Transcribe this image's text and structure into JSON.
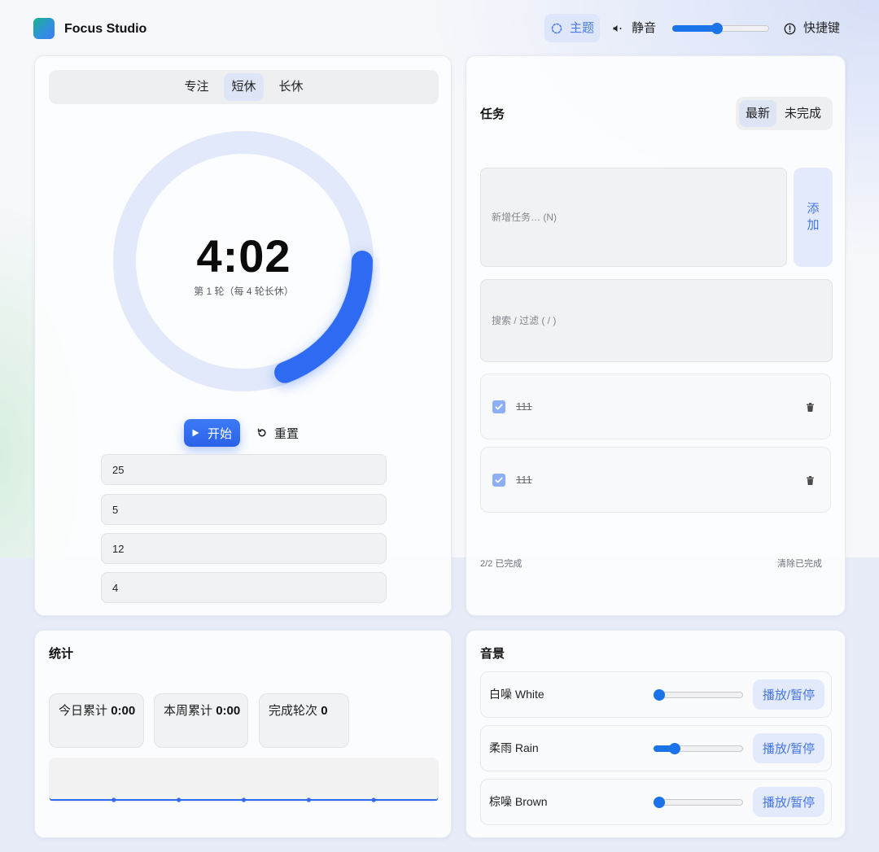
{
  "header": {
    "title": "Focus Studio",
    "theme_label": "主题",
    "theme_icon": "spinner-icon",
    "mute_label": "静音",
    "mute_icon": "speaker-icon",
    "volume": 0.46,
    "shortcuts_label": "快捷键",
    "shortcuts_icon": "info-icon"
  },
  "timer": {
    "modes": [
      {
        "label": "专注",
        "active": false
      },
      {
        "label": "短休",
        "active": true
      },
      {
        "label": "长休",
        "active": false
      }
    ],
    "time": "4:02",
    "round_info": "第 1 轮（每 4 轮长休）",
    "progress": 0.193,
    "start_label": "开始",
    "start_icon": "play-icon",
    "reset_label": "重置",
    "reset_icon": "reset-icon",
    "settings": [
      "25",
      "5",
      "12",
      "4"
    ]
  },
  "tasks": {
    "title": "任务",
    "filters": [
      {
        "label": "最新",
        "active": true
      },
      {
        "label": "未完成",
        "active": false
      }
    ],
    "new_placeholder": "新增任务… (N)",
    "add_label": "添加",
    "search_placeholder": "搜索 / 过滤 ( / )",
    "items": [
      {
        "text": "111",
        "done": true,
        "delete_icon": "trash-icon"
      },
      {
        "text": "111",
        "done": true,
        "delete_icon": "trash-icon"
      }
    ],
    "summary": "2/2 已完成",
    "clear_label": "清除已完成"
  },
  "stats": {
    "title": "统计",
    "cards": [
      {
        "label": "今日累计",
        "value": "0:00"
      },
      {
        "label": "本周累计",
        "value": "0:00"
      },
      {
        "label": "完成轮次",
        "value": "0"
      }
    ],
    "trend": {
      "type": "line",
      "values": [
        0,
        0,
        0,
        0,
        0,
        0,
        0
      ]
    }
  },
  "soundscape": {
    "title": "音景",
    "tracks": [
      {
        "label": "白噪 White",
        "volume": 0,
        "button_label": "播放/暂停"
      },
      {
        "label": "柔雨 Rain",
        "volume": 0.2,
        "button_label": "播放/暂停"
      },
      {
        "label": "棕噪 Brown",
        "volume": 0,
        "button_label": "播放/暂停"
      }
    ]
  },
  "colors": {
    "accent": "#2f6bf2",
    "ring_track": "#e2e9fb",
    "soft_accent": "#e2eafc",
    "soft_accent_text": "#4676e3",
    "slider": "#1a73e8"
  }
}
